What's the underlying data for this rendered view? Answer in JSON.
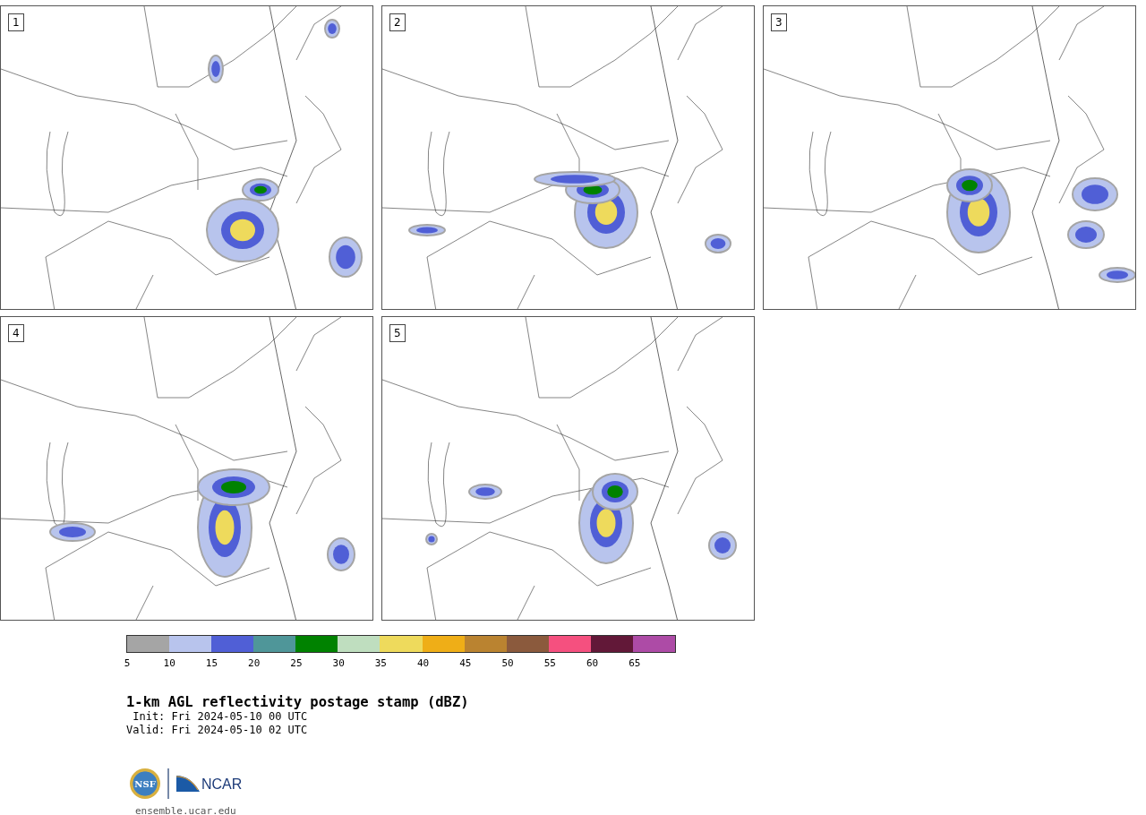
{
  "panels": [
    {
      "label": "1"
    },
    {
      "label": "2"
    },
    {
      "label": "3"
    },
    {
      "label": "4"
    },
    {
      "label": "5"
    }
  ],
  "colorbar": {
    "segments": [
      {
        "color": "#a5a5a5"
      },
      {
        "color": "#b8c4ed"
      },
      {
        "color": "#505fd6"
      },
      {
        "color": "#4f9699"
      },
      {
        "color": "#008200"
      },
      {
        "color": "#bfdebf"
      },
      {
        "color": "#eeda5c"
      },
      {
        "color": "#efae17"
      },
      {
        "color": "#ba8330"
      },
      {
        "color": "#8b5a3d"
      },
      {
        "color": "#f5507f"
      },
      {
        "color": "#621838"
      },
      {
        "color": "#ad4ba6"
      }
    ],
    "ticks": [
      "5",
      "10",
      "15",
      "20",
      "25",
      "30",
      "35",
      "40",
      "45",
      "50",
      "55",
      "60",
      "65"
    ]
  },
  "title": "1-km AGL reflectivity postage stamp (dBZ)",
  "init": " Init: Fri 2024-05-10 00 UTC",
  "valid": "Valid: Fri 2024-05-10 02 UTC",
  "logo": {
    "nsf": "NSF",
    "ncar": "NCAR"
  },
  "site": "ensemble.ucar.edu"
}
